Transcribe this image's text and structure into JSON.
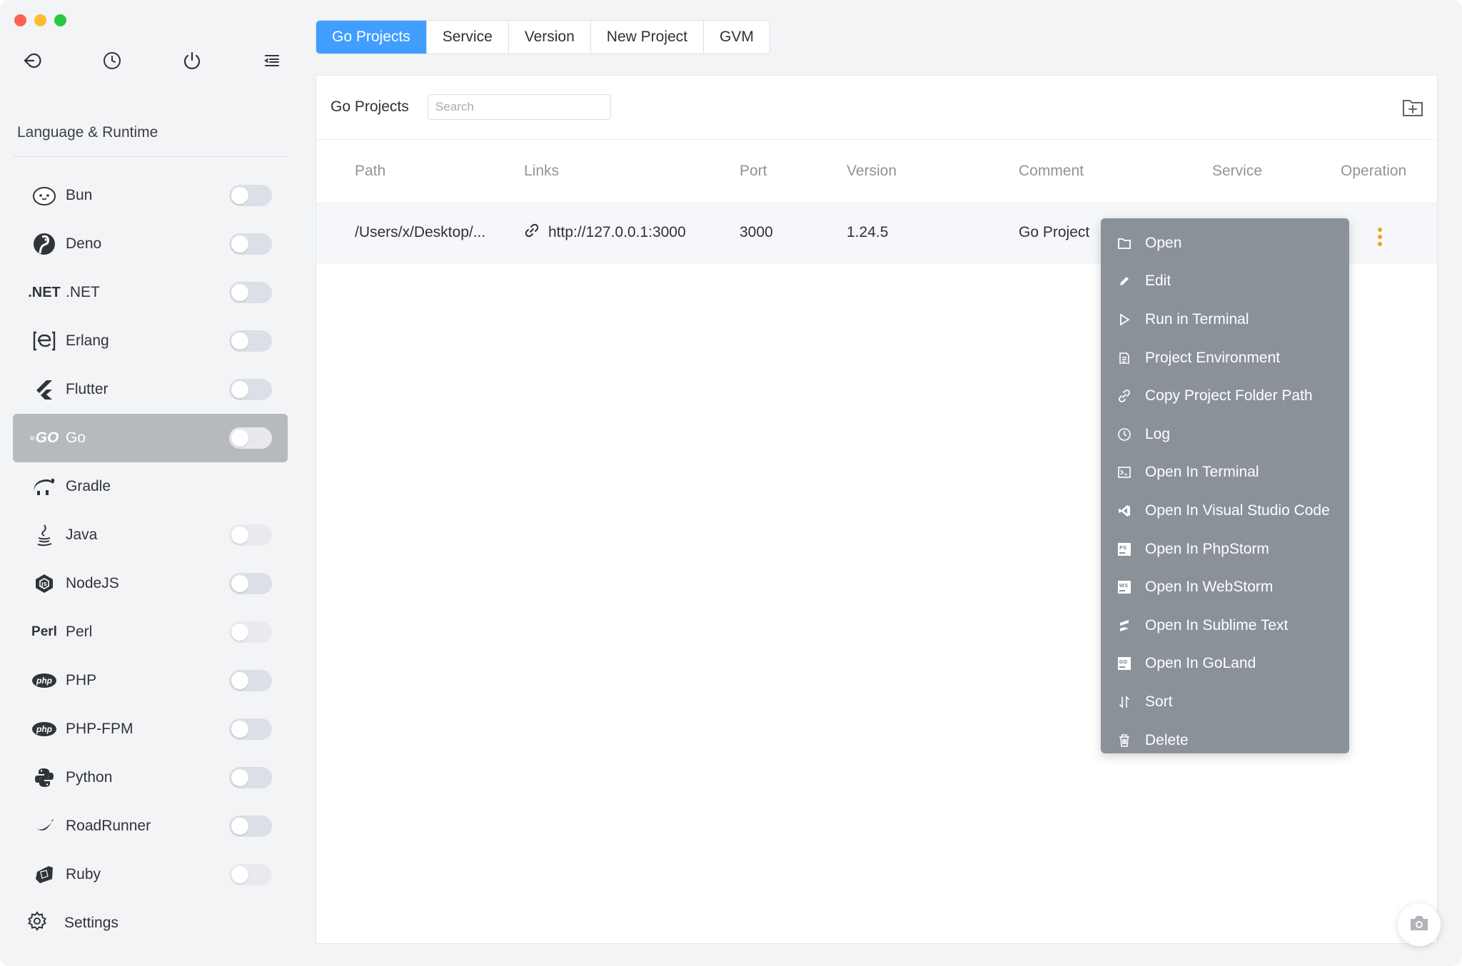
{
  "colors": {
    "accent": "#409eff",
    "menu_bg": "#8a9199",
    "operation_dots": "#f0a020",
    "active_sidebar": "#b6babf"
  },
  "sidebar": {
    "toolbar": [
      {
        "icon": "back-arrow-icon"
      },
      {
        "icon": "clock-icon"
      },
      {
        "icon": "power-icon"
      },
      {
        "icon": "menu-collapse-icon"
      }
    ],
    "section_title": "Language & Runtime",
    "items": [
      {
        "label": "Bun",
        "icon": "bun-icon",
        "toggle": true
      },
      {
        "label": "Deno",
        "icon": "deno-icon",
        "toggle": true
      },
      {
        "label": ".NET",
        "icon": "dotnet-icon",
        "icon_text": ".NET",
        "toggle": true
      },
      {
        "label": "Erlang",
        "icon": "erlang-icon",
        "toggle": true
      },
      {
        "label": "Flutter",
        "icon": "flutter-icon",
        "toggle": true
      },
      {
        "label": "Go",
        "icon": "go-icon",
        "icon_text": "GO",
        "toggle": true,
        "active": true
      },
      {
        "label": "Gradle",
        "icon": "gradle-icon",
        "toggle": false
      },
      {
        "label": "Java",
        "icon": "java-icon",
        "toggle": true,
        "faded": true
      },
      {
        "label": "NodeJS",
        "icon": "nodejs-icon",
        "toggle": true
      },
      {
        "label": "Perl",
        "icon": "perl-icon",
        "icon_text": "Perl",
        "toggle": true,
        "faded": true
      },
      {
        "label": "PHP",
        "icon": "php-icon",
        "icon_text": "php",
        "toggle": true
      },
      {
        "label": "PHP-FPM",
        "icon": "php-fpm-icon",
        "icon_text": "php",
        "toggle": true
      },
      {
        "label": "Python",
        "icon": "python-icon",
        "toggle": true
      },
      {
        "label": "RoadRunner",
        "icon": "roadrunner-icon",
        "toggle": true
      },
      {
        "label": "Ruby",
        "icon": "ruby-icon",
        "toggle": true,
        "faded": true
      }
    ],
    "settings_label": "Settings"
  },
  "tabs": [
    {
      "label": "Go Projects",
      "active": true
    },
    {
      "label": "Service"
    },
    {
      "label": "Version"
    },
    {
      "label": "New Project"
    },
    {
      "label": "GVM"
    }
  ],
  "card": {
    "title": "Go Projects",
    "search_placeholder": "Search"
  },
  "table": {
    "columns": [
      "Path",
      "Links",
      "Port",
      "Version",
      "Comment",
      "Service",
      "Operation"
    ],
    "rows": [
      {
        "path": "/Users/x/Desktop/...",
        "link": "http://127.0.0.1:3000",
        "port": "3000",
        "version": "1.24.5",
        "comment": "Go Project"
      }
    ]
  },
  "context_menu": [
    {
      "label": "Open",
      "icon": "folder-icon"
    },
    {
      "label": "Edit",
      "icon": "pencil-icon"
    },
    {
      "label": "Run in Terminal",
      "icon": "play-icon"
    },
    {
      "label": "Project Environment",
      "icon": "document-icon"
    },
    {
      "label": "Copy Project Folder Path",
      "icon": "copy-link-icon"
    },
    {
      "label": "Log",
      "icon": "clock-icon"
    },
    {
      "label": "Open In Terminal",
      "icon": "terminal-icon"
    },
    {
      "label": "Open In Visual Studio Code",
      "icon": "vscode-icon"
    },
    {
      "label": "Open In PhpStorm",
      "icon": "phpstorm-icon"
    },
    {
      "label": "Open In WebStorm",
      "icon": "webstorm-icon"
    },
    {
      "label": "Open In Sublime Text",
      "icon": "sublime-icon"
    },
    {
      "label": "Open In GoLand",
      "icon": "goland-icon"
    },
    {
      "label": "Sort",
      "icon": "sort-icon"
    },
    {
      "label": "Delete",
      "icon": "trash-icon"
    }
  ]
}
